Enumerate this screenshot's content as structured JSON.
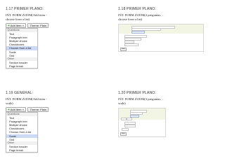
{
  "slides": [
    {
      "heading": "1.17 PRIMER PLANO:",
      "caption": "INT. FORM ZOOM(Add item - choose from a list)"
    },
    {
      "heading": "1.18 PRIMER PLANO:",
      "caption": "INT. FORM ZOOM(2 preguntas…choose from a list)"
    },
    {
      "heading": "1.19 GENERAL:",
      "caption": "INT. FORM ZOOM(Add item - scale)"
    },
    {
      "heading": "1.20 PRIMER PLANO:",
      "caption": "INT. FORM ZOOM(3 preguntas…scale)"
    }
  ],
  "toolbar": {
    "add_item_label": "Add item",
    "theme_label": "Theme:",
    "theme_value": "Plain"
  },
  "menu": {
    "sections": [
      {
        "title": "Questions",
        "items": [
          "Text",
          "Paragraph text",
          "Multiple choice",
          "Checkboxes",
          "Choose from a list",
          "Scale",
          "Grid"
        ]
      },
      {
        "title": "Other",
        "items": [
          "Section header",
          "Page break"
        ]
      }
    ],
    "selected_top": "Choose from a list",
    "selected_bottom": "Scale"
  },
  "form_shot": {
    "done_label": "Done"
  },
  "colors": {
    "selected_bg": "#cbd9f5",
    "plus_green": "#0a8a0a",
    "form_band": "#f3f5e4"
  }
}
